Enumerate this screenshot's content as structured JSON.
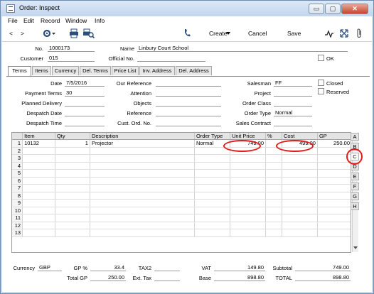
{
  "window": {
    "title": "Order: Inspect",
    "controls": {
      "minimize": "▭",
      "maximize": "▢",
      "close": "✕"
    }
  },
  "menubar": [
    "File",
    "Edit",
    "Record",
    "Window",
    "Info"
  ],
  "toolbar": {
    "back": "<",
    "forward": ">",
    "create": "Create",
    "cancel": "Cancel",
    "save": "Save"
  },
  "header": {
    "no_label": "No.",
    "no_value": "1000173",
    "name_label": "Name",
    "name_value": "Linbury Court School",
    "customer_label": "Customer",
    "customer_value": "015",
    "official_label": "Official No.",
    "official_value": "",
    "ok_label": "OK"
  },
  "tabs": [
    "Terms",
    "Items",
    "Currency",
    "Del. Terms",
    "Price List",
    "Inv. Address",
    "Del. Address"
  ],
  "terms": {
    "date_label": "Date",
    "date_value": "7/5/2016",
    "payterms_label": "Payment Terms",
    "payterms_value": "30",
    "planned_label": "Planned Delivery",
    "planned_value": "",
    "despdate_label": "Despatch Date",
    "despdate_value": "",
    "desptime_label": "Despatch Time",
    "desptime_value": "",
    "ourref_label": "Our Reference",
    "ourref_value": "",
    "attention_label": "Attention",
    "attention_value": "",
    "objects_label": "Objects",
    "objects_value": "",
    "reference_label": "Reference",
    "reference_value": "",
    "custord_label": "Cust. Ord. No.",
    "custord_value": "",
    "salesman_label": "Salesman",
    "salesman_value": "FF",
    "project_label": "Project",
    "project_value": "",
    "orderclass_label": "Order Class",
    "orderclass_value": "",
    "ordertype_label": "Order Type",
    "ordertype_value": "Normal",
    "salescontract_label": "Sales Contract",
    "salescontract_value": "",
    "closed_label": "Closed",
    "reserved_label": "Reserved"
  },
  "grid": {
    "columns": [
      "",
      "Item",
      "Qty",
      "Description",
      "Order Type",
      "Unit Price",
      "%",
      "Cost",
      "GP"
    ],
    "rows": [
      [
        "1",
        "10132",
        "1",
        "Projector",
        "Normal",
        "749.00",
        "",
        "499.00",
        "250.00"
      ],
      [
        "2",
        "",
        "",
        "",
        "",
        "",
        "",
        "",
        ""
      ],
      [
        "3",
        "",
        "",
        "",
        "",
        "",
        "",
        "",
        ""
      ],
      [
        "4",
        "",
        "",
        "",
        "",
        "",
        "",
        "",
        ""
      ],
      [
        "5",
        "",
        "",
        "",
        "",
        "",
        "",
        "",
        ""
      ],
      [
        "6",
        "",
        "",
        "",
        "",
        "",
        "",
        "",
        ""
      ],
      [
        "7",
        "",
        "",
        "",
        "",
        "",
        "",
        "",
        ""
      ],
      [
        "8",
        "",
        "",
        "",
        "",
        "",
        "",
        "",
        ""
      ],
      [
        "9",
        "",
        "",
        "",
        "",
        "",
        "",
        "",
        ""
      ],
      [
        "10",
        "",
        "",
        "",
        "",
        "",
        "",
        "",
        ""
      ],
      [
        "11",
        "",
        "",
        "",
        "",
        "",
        "",
        "",
        ""
      ],
      [
        "12",
        "",
        "",
        "",
        "",
        "",
        "",
        "",
        ""
      ],
      [
        "13",
        "",
        "",
        "",
        "",
        "",
        "",
        "",
        ""
      ]
    ],
    "side_tabs": [
      "A",
      "B",
      "C",
      "D",
      "E",
      "F",
      "G",
      "H"
    ]
  },
  "footer": {
    "currency_label": "Currency",
    "currency_value": "GBP",
    "gp_pct_label": "GP %",
    "gp_pct_value": "33.4",
    "total_gp_label": "Total GP",
    "total_gp_value": "250.00",
    "tax2_label": "TAX2",
    "tax2_value": "",
    "exttax_label": "Ext. Tax",
    "exttax_value": "",
    "vat_label": "VAT",
    "vat_value": "149.80",
    "base_label": "Base",
    "base_value": "898.80",
    "subtotal_label": "Subtotal",
    "subtotal_value": "749.00",
    "total_label": "TOTAL",
    "total_value": "898.80"
  },
  "colors": {
    "highlight_ring": "#e21b1b",
    "titlebar": "#c3d6ee"
  }
}
